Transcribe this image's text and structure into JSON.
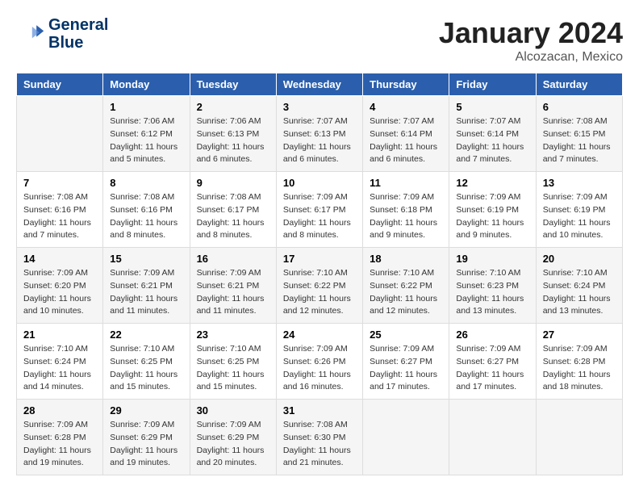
{
  "header": {
    "logo_line1": "General",
    "logo_line2": "Blue",
    "month_year": "January 2024",
    "location": "Alcozacan, Mexico"
  },
  "columns": [
    "Sunday",
    "Monday",
    "Tuesday",
    "Wednesday",
    "Thursday",
    "Friday",
    "Saturday"
  ],
  "weeks": [
    [
      {
        "day": "",
        "info": ""
      },
      {
        "day": "1",
        "info": "Sunrise: 7:06 AM\nSunset: 6:12 PM\nDaylight: 11 hours\nand 5 minutes."
      },
      {
        "day": "2",
        "info": "Sunrise: 7:06 AM\nSunset: 6:13 PM\nDaylight: 11 hours\nand 6 minutes."
      },
      {
        "day": "3",
        "info": "Sunrise: 7:07 AM\nSunset: 6:13 PM\nDaylight: 11 hours\nand 6 minutes."
      },
      {
        "day": "4",
        "info": "Sunrise: 7:07 AM\nSunset: 6:14 PM\nDaylight: 11 hours\nand 6 minutes."
      },
      {
        "day": "5",
        "info": "Sunrise: 7:07 AM\nSunset: 6:14 PM\nDaylight: 11 hours\nand 7 minutes."
      },
      {
        "day": "6",
        "info": "Sunrise: 7:08 AM\nSunset: 6:15 PM\nDaylight: 11 hours\nand 7 minutes."
      }
    ],
    [
      {
        "day": "7",
        "info": "Sunrise: 7:08 AM\nSunset: 6:16 PM\nDaylight: 11 hours\nand 7 minutes."
      },
      {
        "day": "8",
        "info": "Sunrise: 7:08 AM\nSunset: 6:16 PM\nDaylight: 11 hours\nand 8 minutes."
      },
      {
        "day": "9",
        "info": "Sunrise: 7:08 AM\nSunset: 6:17 PM\nDaylight: 11 hours\nand 8 minutes."
      },
      {
        "day": "10",
        "info": "Sunrise: 7:09 AM\nSunset: 6:17 PM\nDaylight: 11 hours\nand 8 minutes."
      },
      {
        "day": "11",
        "info": "Sunrise: 7:09 AM\nSunset: 6:18 PM\nDaylight: 11 hours\nand 9 minutes."
      },
      {
        "day": "12",
        "info": "Sunrise: 7:09 AM\nSunset: 6:19 PM\nDaylight: 11 hours\nand 9 minutes."
      },
      {
        "day": "13",
        "info": "Sunrise: 7:09 AM\nSunset: 6:19 PM\nDaylight: 11 hours\nand 10 minutes."
      }
    ],
    [
      {
        "day": "14",
        "info": "Sunrise: 7:09 AM\nSunset: 6:20 PM\nDaylight: 11 hours\nand 10 minutes."
      },
      {
        "day": "15",
        "info": "Sunrise: 7:09 AM\nSunset: 6:21 PM\nDaylight: 11 hours\nand 11 minutes."
      },
      {
        "day": "16",
        "info": "Sunrise: 7:09 AM\nSunset: 6:21 PM\nDaylight: 11 hours\nand 11 minutes."
      },
      {
        "day": "17",
        "info": "Sunrise: 7:10 AM\nSunset: 6:22 PM\nDaylight: 11 hours\nand 12 minutes."
      },
      {
        "day": "18",
        "info": "Sunrise: 7:10 AM\nSunset: 6:22 PM\nDaylight: 11 hours\nand 12 minutes."
      },
      {
        "day": "19",
        "info": "Sunrise: 7:10 AM\nSunset: 6:23 PM\nDaylight: 11 hours\nand 13 minutes."
      },
      {
        "day": "20",
        "info": "Sunrise: 7:10 AM\nSunset: 6:24 PM\nDaylight: 11 hours\nand 13 minutes."
      }
    ],
    [
      {
        "day": "21",
        "info": "Sunrise: 7:10 AM\nSunset: 6:24 PM\nDaylight: 11 hours\nand 14 minutes."
      },
      {
        "day": "22",
        "info": "Sunrise: 7:10 AM\nSunset: 6:25 PM\nDaylight: 11 hours\nand 15 minutes."
      },
      {
        "day": "23",
        "info": "Sunrise: 7:10 AM\nSunset: 6:25 PM\nDaylight: 11 hours\nand 15 minutes."
      },
      {
        "day": "24",
        "info": "Sunrise: 7:09 AM\nSunset: 6:26 PM\nDaylight: 11 hours\nand 16 minutes."
      },
      {
        "day": "25",
        "info": "Sunrise: 7:09 AM\nSunset: 6:27 PM\nDaylight: 11 hours\nand 17 minutes."
      },
      {
        "day": "26",
        "info": "Sunrise: 7:09 AM\nSunset: 6:27 PM\nDaylight: 11 hours\nand 17 minutes."
      },
      {
        "day": "27",
        "info": "Sunrise: 7:09 AM\nSunset: 6:28 PM\nDaylight: 11 hours\nand 18 minutes."
      }
    ],
    [
      {
        "day": "28",
        "info": "Sunrise: 7:09 AM\nSunset: 6:28 PM\nDaylight: 11 hours\nand 19 minutes."
      },
      {
        "day": "29",
        "info": "Sunrise: 7:09 AM\nSunset: 6:29 PM\nDaylight: 11 hours\nand 19 minutes."
      },
      {
        "day": "30",
        "info": "Sunrise: 7:09 AM\nSunset: 6:29 PM\nDaylight: 11 hours\nand 20 minutes."
      },
      {
        "day": "31",
        "info": "Sunrise: 7:08 AM\nSunset: 6:30 PM\nDaylight: 11 hours\nand 21 minutes."
      },
      {
        "day": "",
        "info": ""
      },
      {
        "day": "",
        "info": ""
      },
      {
        "day": "",
        "info": ""
      }
    ]
  ]
}
